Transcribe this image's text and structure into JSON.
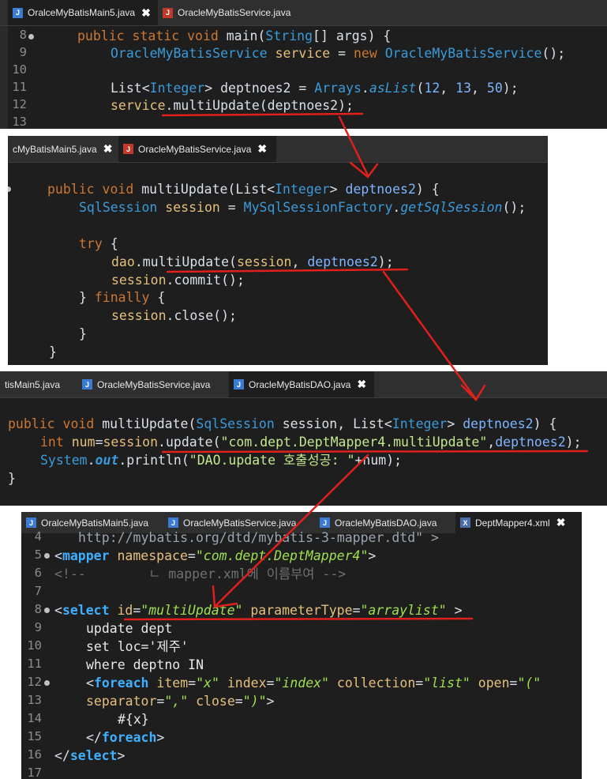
{
  "panel1": {
    "tabs": [
      {
        "label": "OralceMyBatisMain5.java",
        "close": "✖",
        "icon": "J"
      },
      {
        "label": "OracleMyBatisService.java",
        "icon": "J"
      }
    ],
    "line_numbers": [
      "8",
      "9",
      "10",
      "11",
      "12",
      "13"
    ],
    "lines": {
      "l8_a": "public static void",
      "l8_b": " main(",
      "l8_c": "String",
      "l8_d": "[] args) {",
      "l9_a": "OracleMyBatisService",
      "l9_b": " service",
      "l9_c": " = ",
      "l9_d": "new",
      "l9_e": " OracleMyBatisService",
      "l9_f": "();",
      "l11_a": "List<",
      "l11_b": "Integer",
      "l11_c": "> deptnoes2 = ",
      "l11_d": "Arrays",
      "l11_e": ".",
      "l11_f": "asList",
      "l11_g": "(",
      "l11_h": "12",
      "l11_i": ", ",
      "l11_j": "13",
      "l11_k": ", ",
      "l11_l": "50",
      "l11_m": ");",
      "l12_a": "service",
      "l12_b": ".multiUpdate(deptnoes2);"
    }
  },
  "panel2": {
    "tabs": [
      {
        "label": "cMyBatisMain5.java",
        "close": "✖",
        "icon": ""
      },
      {
        "label": "OracleMyBatisService.java",
        "close": "✖",
        "icon": "J"
      }
    ],
    "lines": {
      "a1": "public void",
      "a2": " multiUpdate(",
      "a3": "List<",
      "a4": "Integer",
      "a5": "> ",
      "a6": "deptnoes2",
      "a7": ") {",
      "b1": "SqlSession",
      "b2": " session",
      "b3": " = ",
      "b4": "MySqlSessionFactory",
      "b5": ".",
      "b6": "getSqlSession",
      "b7": "();",
      "c1": "try",
      "c2": " {",
      "d1": "dao",
      "d2": ".multiUpdate(",
      "d3": "session",
      "d4": ", ",
      "d5": "deptnoes2",
      "d6": ");",
      "e1": "session",
      "e2": ".commit();",
      "f1": "} ",
      "f2": "finally",
      "f3": " {",
      "g1": "session",
      "g2": ".close();",
      "h1": "}",
      "i1": "}"
    }
  },
  "panel3": {
    "tabs": [
      {
        "label": "tisMain5.java",
        "icon": ""
      },
      {
        "label": "OracleMyBatisService.java",
        "icon": "J"
      },
      {
        "label": "OracleMyBatisDAO.java",
        "close": "✖",
        "icon": "J"
      }
    ],
    "lines": {
      "a1": "public void",
      "a2": " multiUpdate(",
      "a3": "SqlSession",
      "a4": " session, ",
      "a5": "List<",
      "a6": "Integer",
      "a7": "> ",
      "a8": "deptnoes2",
      "a9": ") {",
      "b1": "int",
      "b2": " num",
      "b3": "=",
      "b4": "session",
      "b5": ".update(",
      "b6": "\"com.dept.DeptMapper4.multiUpdate\"",
      "b7": ",",
      "b8": "deptnoes2",
      "b9": ");",
      "c1": "System",
      "c2": ".",
      "c3": "out",
      "c4": ".println(",
      "c5": "\"DAO.update 호출성공: \"",
      "c6": "+num);",
      "d1": "}"
    }
  },
  "panel4": {
    "tabs": [
      {
        "label": "OralceMyBatisMain5.java",
        "icon": "J"
      },
      {
        "label": "OracleMyBatisService.java",
        "icon": "J"
      },
      {
        "label": "OracleMyBatisDAO.java",
        "icon": "J"
      },
      {
        "label": "DeptMapper4.xml",
        "close": "✖",
        "icon": "X"
      }
    ],
    "line_numbers": [
      "4",
      "5",
      "6",
      "7",
      "8",
      "9",
      "10",
      "11",
      "12",
      "13",
      "14",
      "15",
      "16",
      "17"
    ],
    "lines": {
      "l4": "http://mybatis.org/dtd/mybatis-3-mapper.dtd\" >",
      "l5_a": "<",
      "l5_b": "mapper",
      "l5_c": " namespace",
      "l5_d": "=",
      "l5_e": "\"com.dept.DeptMapper4\"",
      "l5_f": ">",
      "l6": "<!--        ㄴ mapper.xml에 이름부여 -->",
      "l8_a": "<",
      "l8_b": "select",
      "l8_c": " id",
      "l8_d": "=",
      "l8_e": "\"multiUpdate\"",
      "l8_f": " parameterType",
      "l8_g": "=",
      "l8_h": "\"arraylist\"",
      "l8_i": " >",
      "l9": "update dept",
      "l10": "set loc='제주'",
      "l11": "where deptno IN",
      "l12_a": "<",
      "l12_b": "foreach",
      "l12_c": " item",
      "l12_d": "=",
      "l12_e": "\"x\"",
      "l12_f": " index",
      "l12_g": "=",
      "l12_h": "\"index\"",
      "l12_i": " collection",
      "l12_j": "=",
      "l12_k": "\"list\"",
      "l12_l": " open",
      "l12_m": "=",
      "l12_n": "\"(\"",
      "l13_a": "separator",
      "l13_b": "=",
      "l13_c": "\",\"",
      "l13_d": " close",
      "l13_e": "=",
      "l13_f": "\")\"",
      "l13_g": ">",
      "l14": "#{x}",
      "l15_a": "</",
      "l15_b": "foreach",
      "l15_c": ">",
      "l16_a": "</",
      "l16_b": "select",
      "l16_c": ">"
    }
  },
  "colors": {
    "annotation": "#e0201c",
    "editor_bg": "#1e1e1e",
    "tab_bg": "#2f2f2f"
  }
}
